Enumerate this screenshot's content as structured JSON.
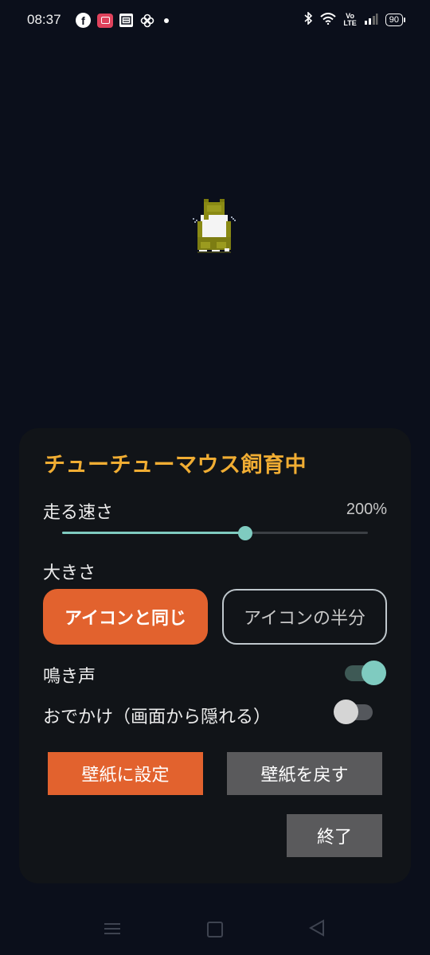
{
  "status_bar": {
    "time": "08:37",
    "notification_icons": [
      "facebook-icon",
      "screen-record-icon",
      "news-icon",
      "pinwheel-icon"
    ],
    "system_icons": [
      "bluetooth-icon",
      "wifi-icon",
      "volte-icon",
      "signal-icon",
      "battery-icon"
    ],
    "volte_top": "Vo",
    "volte_bottom": "LTE",
    "battery": "90"
  },
  "panel": {
    "title": "チューチューマウス飼育中",
    "speed": {
      "label": "走る速さ",
      "value_text": "200%",
      "level": 0.6
    },
    "size": {
      "label": "大きさ",
      "option_same": "アイコンと同じ",
      "option_half": "アイコンの半分",
      "selected": "アイコンと同じ"
    },
    "sound": {
      "label": "鳴き声",
      "enabled": true
    },
    "outing": {
      "label": "おでかけ（画面から隠れる）",
      "enabled": false
    },
    "buttons": {
      "set_wallpaper": "壁紙に設定",
      "restore_wallpaper": "壁紙を戻す",
      "quit": "終了"
    }
  },
  "colors": {
    "background": "#0b0f1b",
    "panel": "#111418",
    "title": "#f0ad33",
    "accent_orange": "#e2622e",
    "accent_teal": "#7fcbc0",
    "button_gray": "#5a5a5c"
  }
}
